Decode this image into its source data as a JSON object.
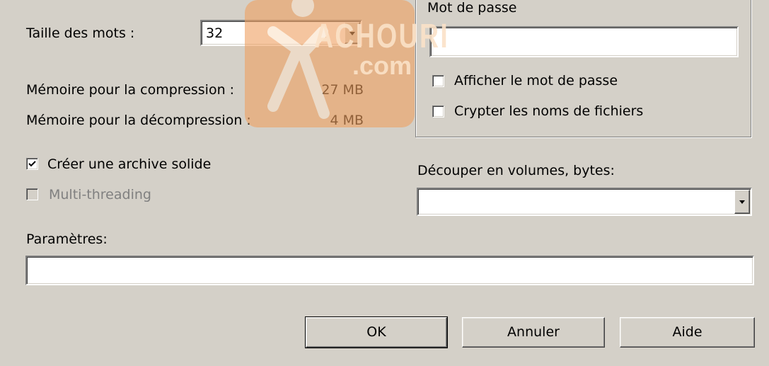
{
  "compression": {
    "word_size_label": "Taille des mots :",
    "word_size_value": "32",
    "mem_compress_label": "Mémoire pour la compression :",
    "mem_compress_value": "27 MB",
    "mem_decompress_label": "Mémoire pour la décompression :",
    "mem_decompress_value": "4 MB"
  },
  "options": {
    "solid_archive_label": "Créer une archive solide",
    "solid_archive_checked": true,
    "multithreading_label": "Multi-threading",
    "multithreading_checked": false
  },
  "encryption": {
    "group_label": "Mot de passe",
    "password_value": "",
    "show_password_label": "Afficher le mot de passe",
    "encrypt_names_label": "Crypter les noms de fichiers"
  },
  "volumes": {
    "label": "Découper en volumes, bytes:",
    "value": ""
  },
  "parameters": {
    "label": "Paramètres:",
    "value": ""
  },
  "buttons": {
    "ok": "OK",
    "cancel": "Annuler",
    "help": "Aide"
  },
  "watermark": {
    "text_main": "ACHOURI",
    "text_sub": ".com",
    "color": "#f0a060"
  },
  "colors": {
    "dialog_bg": "#d4d0c8",
    "disabled_text": "#808080"
  }
}
